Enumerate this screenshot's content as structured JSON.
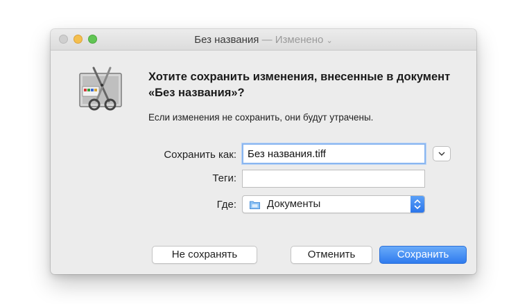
{
  "window": {
    "title": "Без названия",
    "title_separator": "—",
    "title_status": "Изменено",
    "title_chevron": "⌄"
  },
  "dialog": {
    "heading": "Хотите сохранить изменения, внесенные в документ «Без названия»?",
    "message": "Если изменения не сохранить, они будут утрачены."
  },
  "form": {
    "save_as_label": "Сохранить как:",
    "save_as_value": "Без названия.tiff",
    "tags_label": "Теги:",
    "tags_value": "",
    "where_label": "Где:",
    "where_value": "Документы",
    "expand_icon": "chevron-down-icon",
    "folder_icon": "folder-icon"
  },
  "buttons": {
    "dont_save": "Не сохранять",
    "cancel": "Отменить",
    "save": "Сохранить"
  },
  "colors": {
    "accent": "#2f7bee",
    "close": "#cfcfcf",
    "minimize": "#f4bf4f",
    "maximize": "#61c554"
  }
}
